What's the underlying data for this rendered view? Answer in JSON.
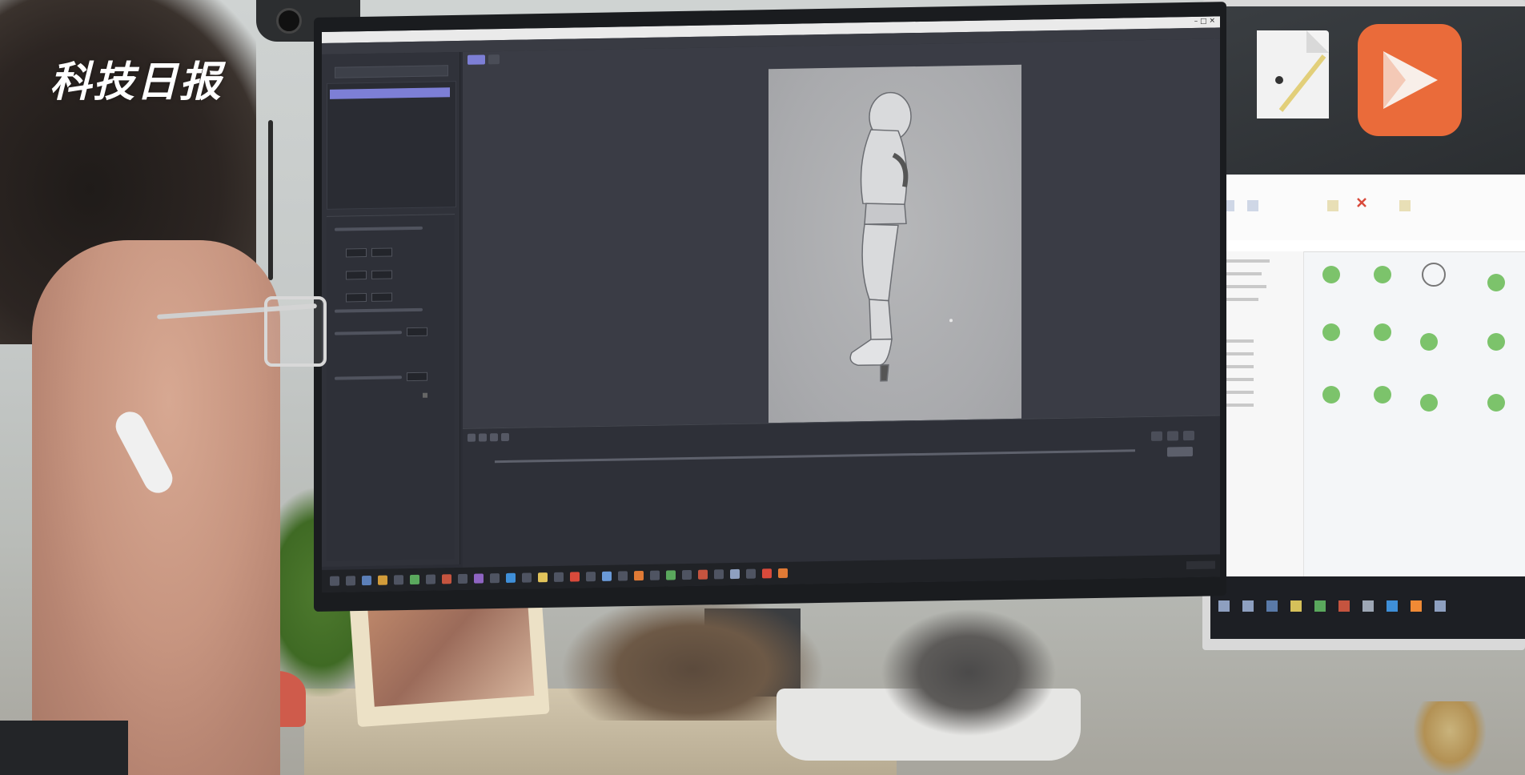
{
  "watermark": {
    "text": "科技日报"
  },
  "app": {
    "title": "",
    "menu": [
      "",
      "",
      "",
      "",
      ""
    ],
    "left_panel": {
      "selected_item": ""
    },
    "viewport": {
      "tabs": [
        "",
        ""
      ]
    },
    "timeline": {
      "log_lines": [
        "",
        "",
        ""
      ]
    },
    "status": {
      "line1": "",
      "line2": ""
    }
  },
  "colors": {
    "accent": "#7d7fd6",
    "app_bg": "#2b2d35",
    "canvas_bg": "#a9aaad",
    "explorer_ok": "#7cc36b",
    "video_icon": "#ea6b3a"
  },
  "icons": {
    "close": "close-icon",
    "minimize": "minimize-icon",
    "maximize": "maximize-icon",
    "doc": "document-icon",
    "video": "video-player-icon",
    "delete": "delete-icon"
  }
}
